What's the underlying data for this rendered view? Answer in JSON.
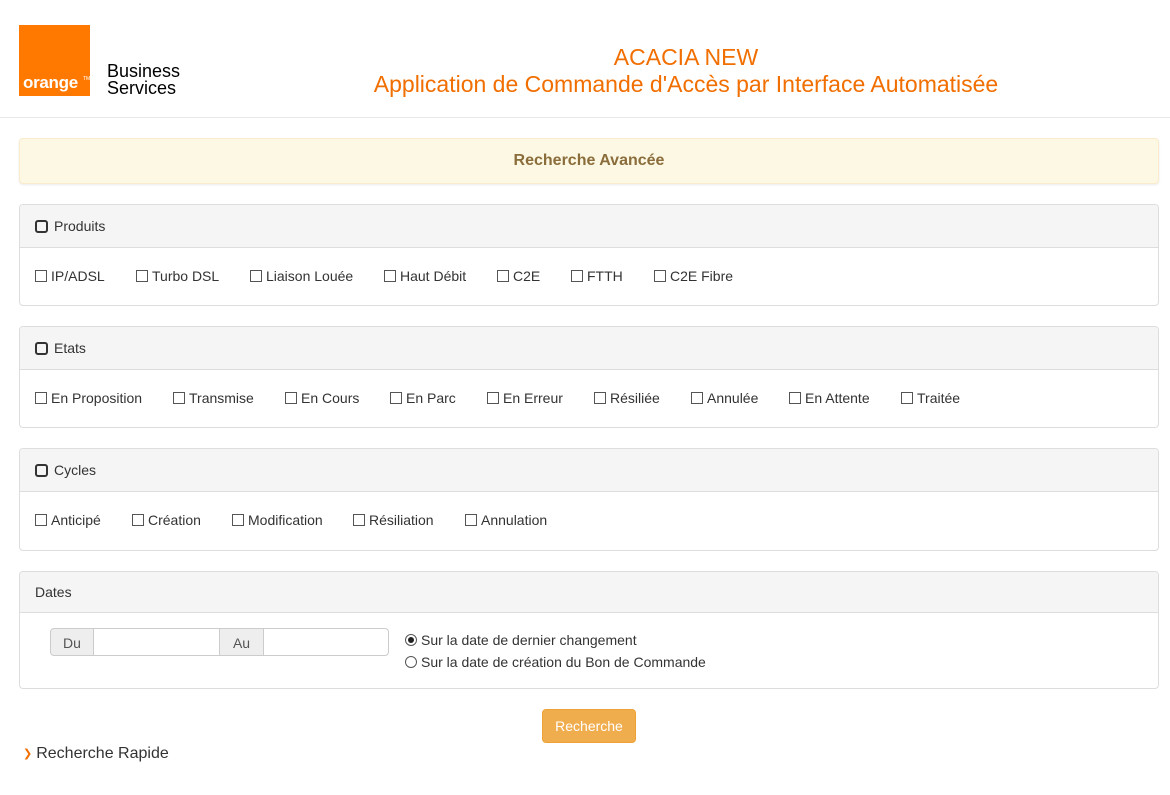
{
  "header": {
    "logo_text": "orange",
    "logo_tm": "TM",
    "brand_line1": "Business",
    "brand_line2": "Services",
    "title_line1": "ACACIA NEW",
    "title_line2": "Application de Commande d'Accès par Interface Automatisée"
  },
  "banner": {
    "title": "Recherche Avancée"
  },
  "produits": {
    "title": "Produits",
    "options": [
      "IP/ADSL",
      "Turbo DSL",
      "Liaison Louée",
      "Haut Débit",
      "C2E",
      "FTTH",
      "C2E Fibre"
    ]
  },
  "etats": {
    "title": "Etats",
    "options": [
      "En Proposition",
      "Transmise",
      "En Cours",
      "En Parc",
      "En Erreur",
      "Résiliée",
      "Annulée",
      "En Attente",
      "Traitée"
    ]
  },
  "cycles": {
    "title": "Cycles",
    "options": [
      "Anticipé",
      "Création",
      "Modification",
      "Résiliation",
      "Annulation"
    ]
  },
  "dates": {
    "title": "Dates",
    "from_label": "Du",
    "to_label": "Au",
    "from_value": "",
    "to_value": "",
    "radio_options": [
      "Sur la date de dernier changement",
      "Sur la date de création du Bon de Commande"
    ],
    "radio_selected": "Sur la date de dernier changement"
  },
  "actions": {
    "search_label": "Recherche"
  },
  "footer": {
    "quick_search_label": "Recherche Rapide"
  },
  "colors": {
    "brand_orange": "#ff7900",
    "title_orange": "#f16e00",
    "button": "#f0ad4e",
    "banner_bg": "#fcf8e3",
    "banner_text": "#8a6d3b"
  }
}
